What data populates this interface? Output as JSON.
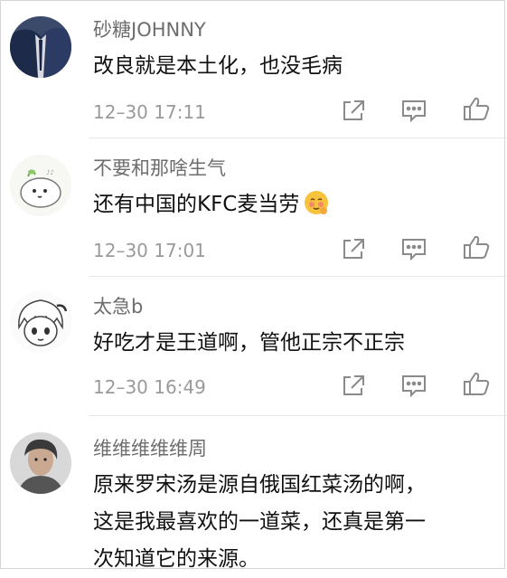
{
  "comments": [
    {
      "name": "砂糖JOHNNY",
      "lines": [
        "改良就是本土化，也没毛病"
      ],
      "time": "12–30 17:11",
      "avatar": "suit-avatar"
    },
    {
      "name": "不要和那啥生气",
      "lines": [
        "还有中国的KFC麦当劳"
      ],
      "time": "12–30 17:01",
      "avatar": "cartoon-bun-avatar",
      "emoji": "blushing-face-emoji"
    },
    {
      "name": "太急b",
      "lines": [
        "好吃才是王道啊，管他正宗不正宗"
      ],
      "time": "12–30 16:49",
      "avatar": "anime-avatar"
    },
    {
      "name": "维维维维维周",
      "lines": [
        "原来罗宋汤是源自俄国红菜汤的啊，",
        "这是我最喜欢的一道菜，还真是第一",
        "次知道它的来源。"
      ],
      "avatar": "photo-avatar"
    }
  ],
  "actions": {
    "share_icon": "share-icon",
    "comment_icon": "comment-icon",
    "like_icon": "like-icon"
  },
  "colors": {
    "name": "#6d6d6d",
    "text": "#111111",
    "time": "#9a9a9a",
    "icon": "#8a8a8a"
  }
}
